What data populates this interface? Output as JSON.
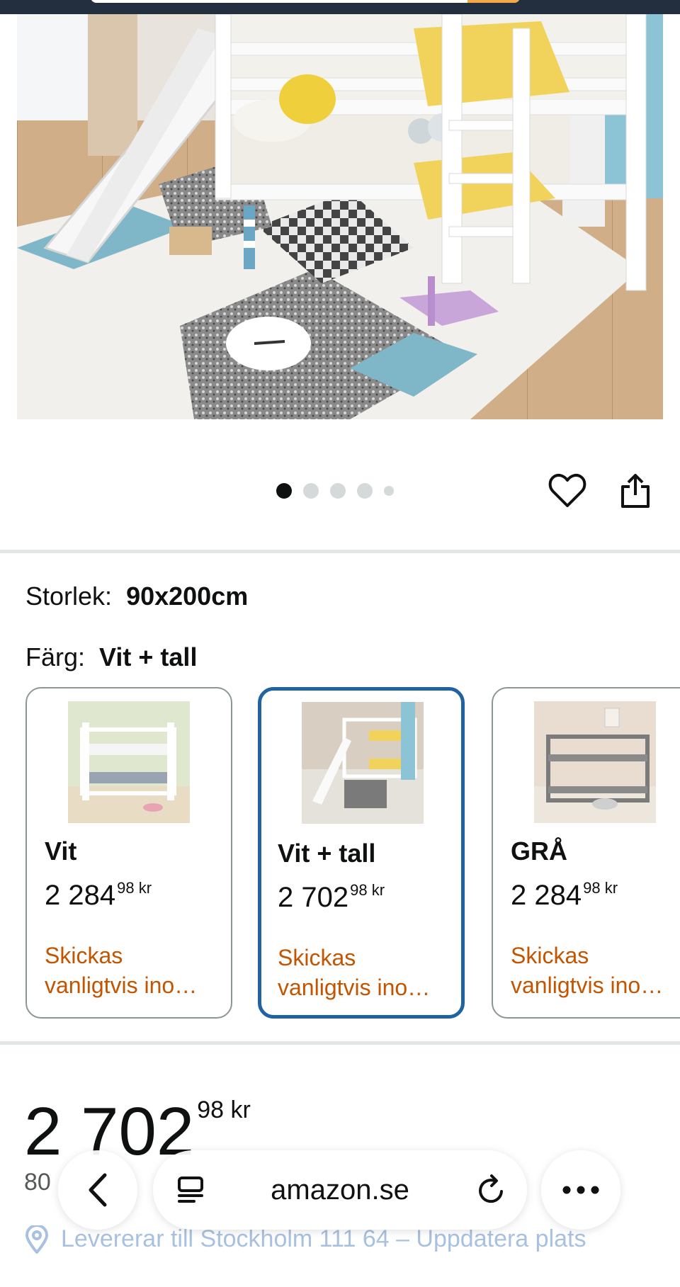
{
  "product": {
    "gallery": {
      "dot_count": 5,
      "active_index": 0
    },
    "size": {
      "label": "Storlek:",
      "value": "90x200cm"
    },
    "color": {
      "label": "Färg:",
      "value": "Vit + tall"
    },
    "swatches": [
      {
        "name": "Vit",
        "price_main": "2 284",
        "price_frac": "98 kr",
        "shipping": "Skickas vanligtvis ino…",
        "selected": false
      },
      {
        "name": "Vit + tall",
        "price_main": "2 702",
        "price_frac": "98 kr",
        "shipping": "Skickas vanligtvis ino…",
        "selected": true
      },
      {
        "name": "GRÅ",
        "price_main": "2 284",
        "price_frac": "98 kr",
        "shipping": "Skickas vanligtvis ino…",
        "selected": false
      }
    ],
    "price": {
      "main": "2 702",
      "fraction": "98 kr"
    },
    "partial_line": "80",
    "delivery_text": "Levererar till Stockholm 111 64 – Uppdatera plats"
  },
  "browser": {
    "url": "amazon.se"
  },
  "colors": {
    "selected_border": "#2162a1",
    "shipping_text": "#c45500",
    "header_bg": "#232f3e"
  }
}
